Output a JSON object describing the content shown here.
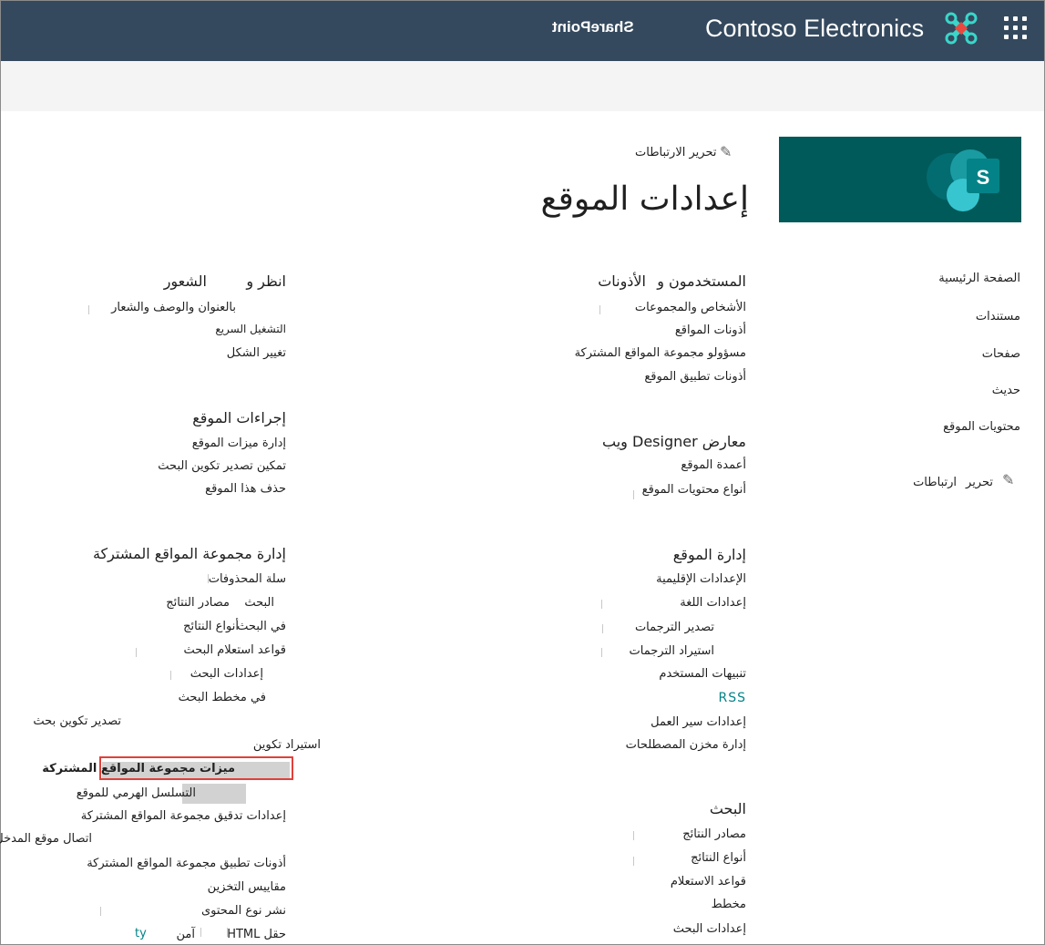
{
  "suite_bar": {
    "brand_name": "Contoso Electronics",
    "product_name": "SharePoint",
    "background": "#34495e",
    "icons": [
      "waffle-icon",
      "brand-logo-icon"
    ]
  },
  "site_logo": {
    "background": "#005a5a",
    "letter": "S"
  },
  "header": {
    "edit_links": "تحرير الارتباطات",
    "page_title": "إعدادات الموقع"
  },
  "left_nav": {
    "items": [
      {
        "label": "الصفحة الرئيسية"
      },
      {
        "label": "مستندات"
      },
      {
        "label": "صفحات"
      },
      {
        "label": "حديث"
      },
      {
        "label": "محتويات الموقع"
      }
    ],
    "edit_label": "تحرير",
    "edit_links_label": "ارتباطات"
  },
  "sections": {
    "users": {
      "heading_main": "المستخدمون و",
      "heading_sub": "الأذونات",
      "links": [
        "الأشخاص والمجموعات",
        "أذونات المواقع",
        "مسؤولو مجموعة المواقع المشتركة",
        "أذونات تطبيق الموقع"
      ]
    },
    "web_designer": {
      "heading": "معارض Designer ويب",
      "links": [
        "أعمدة الموقع",
        "أنواع محتويات الموقع"
      ]
    },
    "site_admin": {
      "heading": "إدارة الموقع",
      "links": [
        "الإعدادات الإقليمية",
        "إعدادات اللغة",
        "تصدير الترجمات",
        "استيراد الترجمات",
        "تنبيهات المستخدم",
        "RSS",
        "إعدادات سير العمل",
        "إدارة مخزن المصطلحات"
      ]
    },
    "search": {
      "heading": "البحث",
      "links": [
        "مصادر النتائج",
        "أنواع النتائج",
        "قواعد الاستعلام",
        "مخطط",
        "إعدادات البحث"
      ]
    },
    "look_feel": {
      "heading_main": "انظر و",
      "heading_sub": "الشعور",
      "links": [
        "بالعنوان والوصف والشعار",
        "التشغيل السريع",
        "تغيير الشكل"
      ]
    },
    "site_actions": {
      "heading": "إجراءات الموقع",
      "links": [
        "إدارة ميزات الموقع",
        "تمكين تصدير تكوين البحث",
        "حذف هذا الموقع"
      ]
    },
    "collection_admin": {
      "heading": "إدارة مجموعة المواقع المشتركة",
      "links": {
        "recycle_bin": "سلة المحذوفات",
        "result_sources_a": "البحث",
        "result_sources_b": "مصادر النتائج",
        "result_types_a": "في البحث",
        "result_types_b": "أنواع النتائج",
        "query_rules": "قواعد استعلام البحث",
        "search_settings": "إعدادات البحث",
        "search_schema": "في مخطط البحث",
        "export_config": "تصدير تكوين بحث",
        "import_config": "استيراد تكوين",
        "features": "ميزات مجموعة المواقع المشتركة",
        "hierarchy": "التسلسل الهرمي للموقع",
        "audit": "إعدادات تدقيق مجموعة المواقع المشتركة",
        "portal": "اتصال موقع المدخل",
        "app_perms": "أذونات تطبيق مجموعة المواقع المشتركة",
        "storage": "مقاييس التخزين",
        "content_type": "نشر نوع المحتوى",
        "html_a": "حقل HTML",
        "html_b": "آمن",
        "html_c": "ty"
      }
    }
  },
  "accent_colors": {
    "highlight_border": "#e0413a",
    "teal": "#038387"
  }
}
